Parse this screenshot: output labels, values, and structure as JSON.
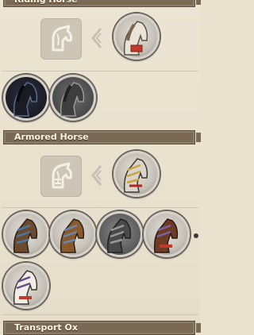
{
  "sections": [
    {
      "title": "Riding Horse"
    },
    {
      "title": "Armored Horse"
    },
    {
      "title": "Transport Ox"
    }
  ],
  "icons": {
    "category": "horse-head-icon",
    "arrow": "chevron-left-icon"
  }
}
